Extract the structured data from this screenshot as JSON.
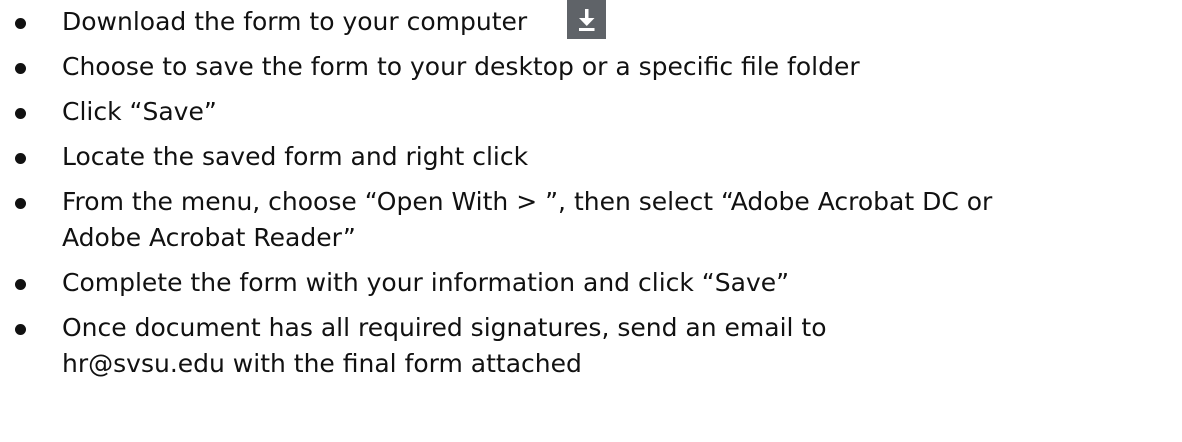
{
  "instructions": {
    "items": [
      {
        "text": "Download the form to your computer",
        "icon": "download-icon"
      },
      {
        "text": "Choose to save the form to your desktop or a specific file folder"
      },
      {
        "text": "Click “Save”"
      },
      {
        "text": "Locate the saved form and right click"
      },
      {
        "lines": [
          "From the menu, choose “Open With > ”, then select “Adobe Acrobat DC or",
          "Adobe Acrobat Reader”"
        ]
      },
      {
        "text": "Complete the form with your information and click “Save”"
      },
      {
        "lines": [
          "Once document has all required signatures, send an email to",
          "hr@svsu.edu with the final form attached"
        ]
      }
    ]
  },
  "colors": {
    "text": "#111111",
    "download_button_bg": "#5f6368",
    "download_icon": "#ffffff"
  }
}
